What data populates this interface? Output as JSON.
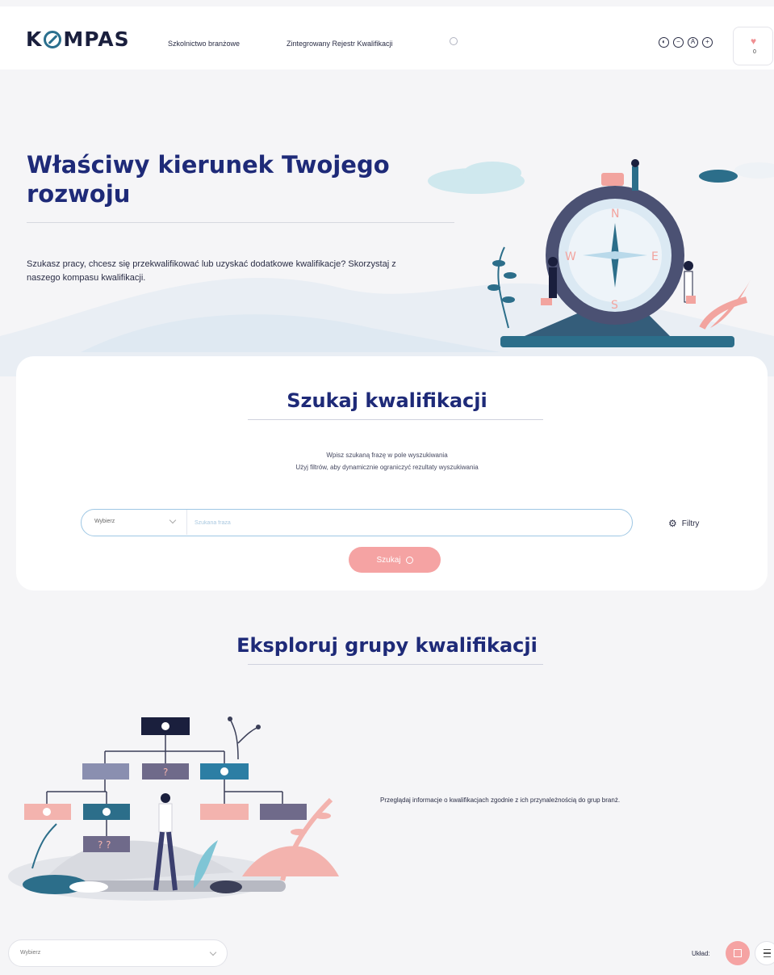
{
  "brand": {
    "logo_text_left": "K",
    "logo_text_right": "MPAS"
  },
  "nav": {
    "items": [
      "Szkolnictwo branżowe",
      "Zintegrowany Rejestr Kwalifikacji"
    ]
  },
  "accessibility": {
    "contrast": "◐",
    "font_smaller": "−",
    "font_reset": "A",
    "font_larger": "+"
  },
  "favorites": {
    "count": "0"
  },
  "hero": {
    "title": "Właściwy kierunek Twojego rozwoju",
    "description": "Szukasz pracy, chcesz się przekwalifikować lub uzyskać dodatkowe kwalifikacje? Skorzystaj z naszego kompasu kwalifikacji.",
    "compass_letters": {
      "n": "N",
      "e": "E",
      "s": "S",
      "w": "W"
    }
  },
  "search": {
    "title": "Szukaj kwalifikacji",
    "instruction_line1": "Wpisz szukaną frazę w pole wyszukiwania",
    "instruction_line2": "Użyj filtrów, aby dynamicznie ograniczyć rezultaty wyszukiwania",
    "select_label": "Wybierz",
    "input_placeholder": "Szukana fraza",
    "filters_label": "Filtry",
    "button_label": "Szukaj"
  },
  "explore": {
    "title": "Eksploruj grupy kwalifikacji",
    "description": "Przeglądaj informacje o kwalifikacjach zgodnie z ich przynależnością do grup branż.",
    "chart_marks": {
      "q1": "?",
      "q2": "? ?"
    }
  },
  "bottom": {
    "select_label": "Wybierz",
    "layout_label": "Układ:"
  },
  "colors": {
    "accent": "#1e2a78",
    "pink": "#f5a3a3",
    "teal": "#2a6f8e",
    "navy_dark": "#1a1f3d"
  }
}
